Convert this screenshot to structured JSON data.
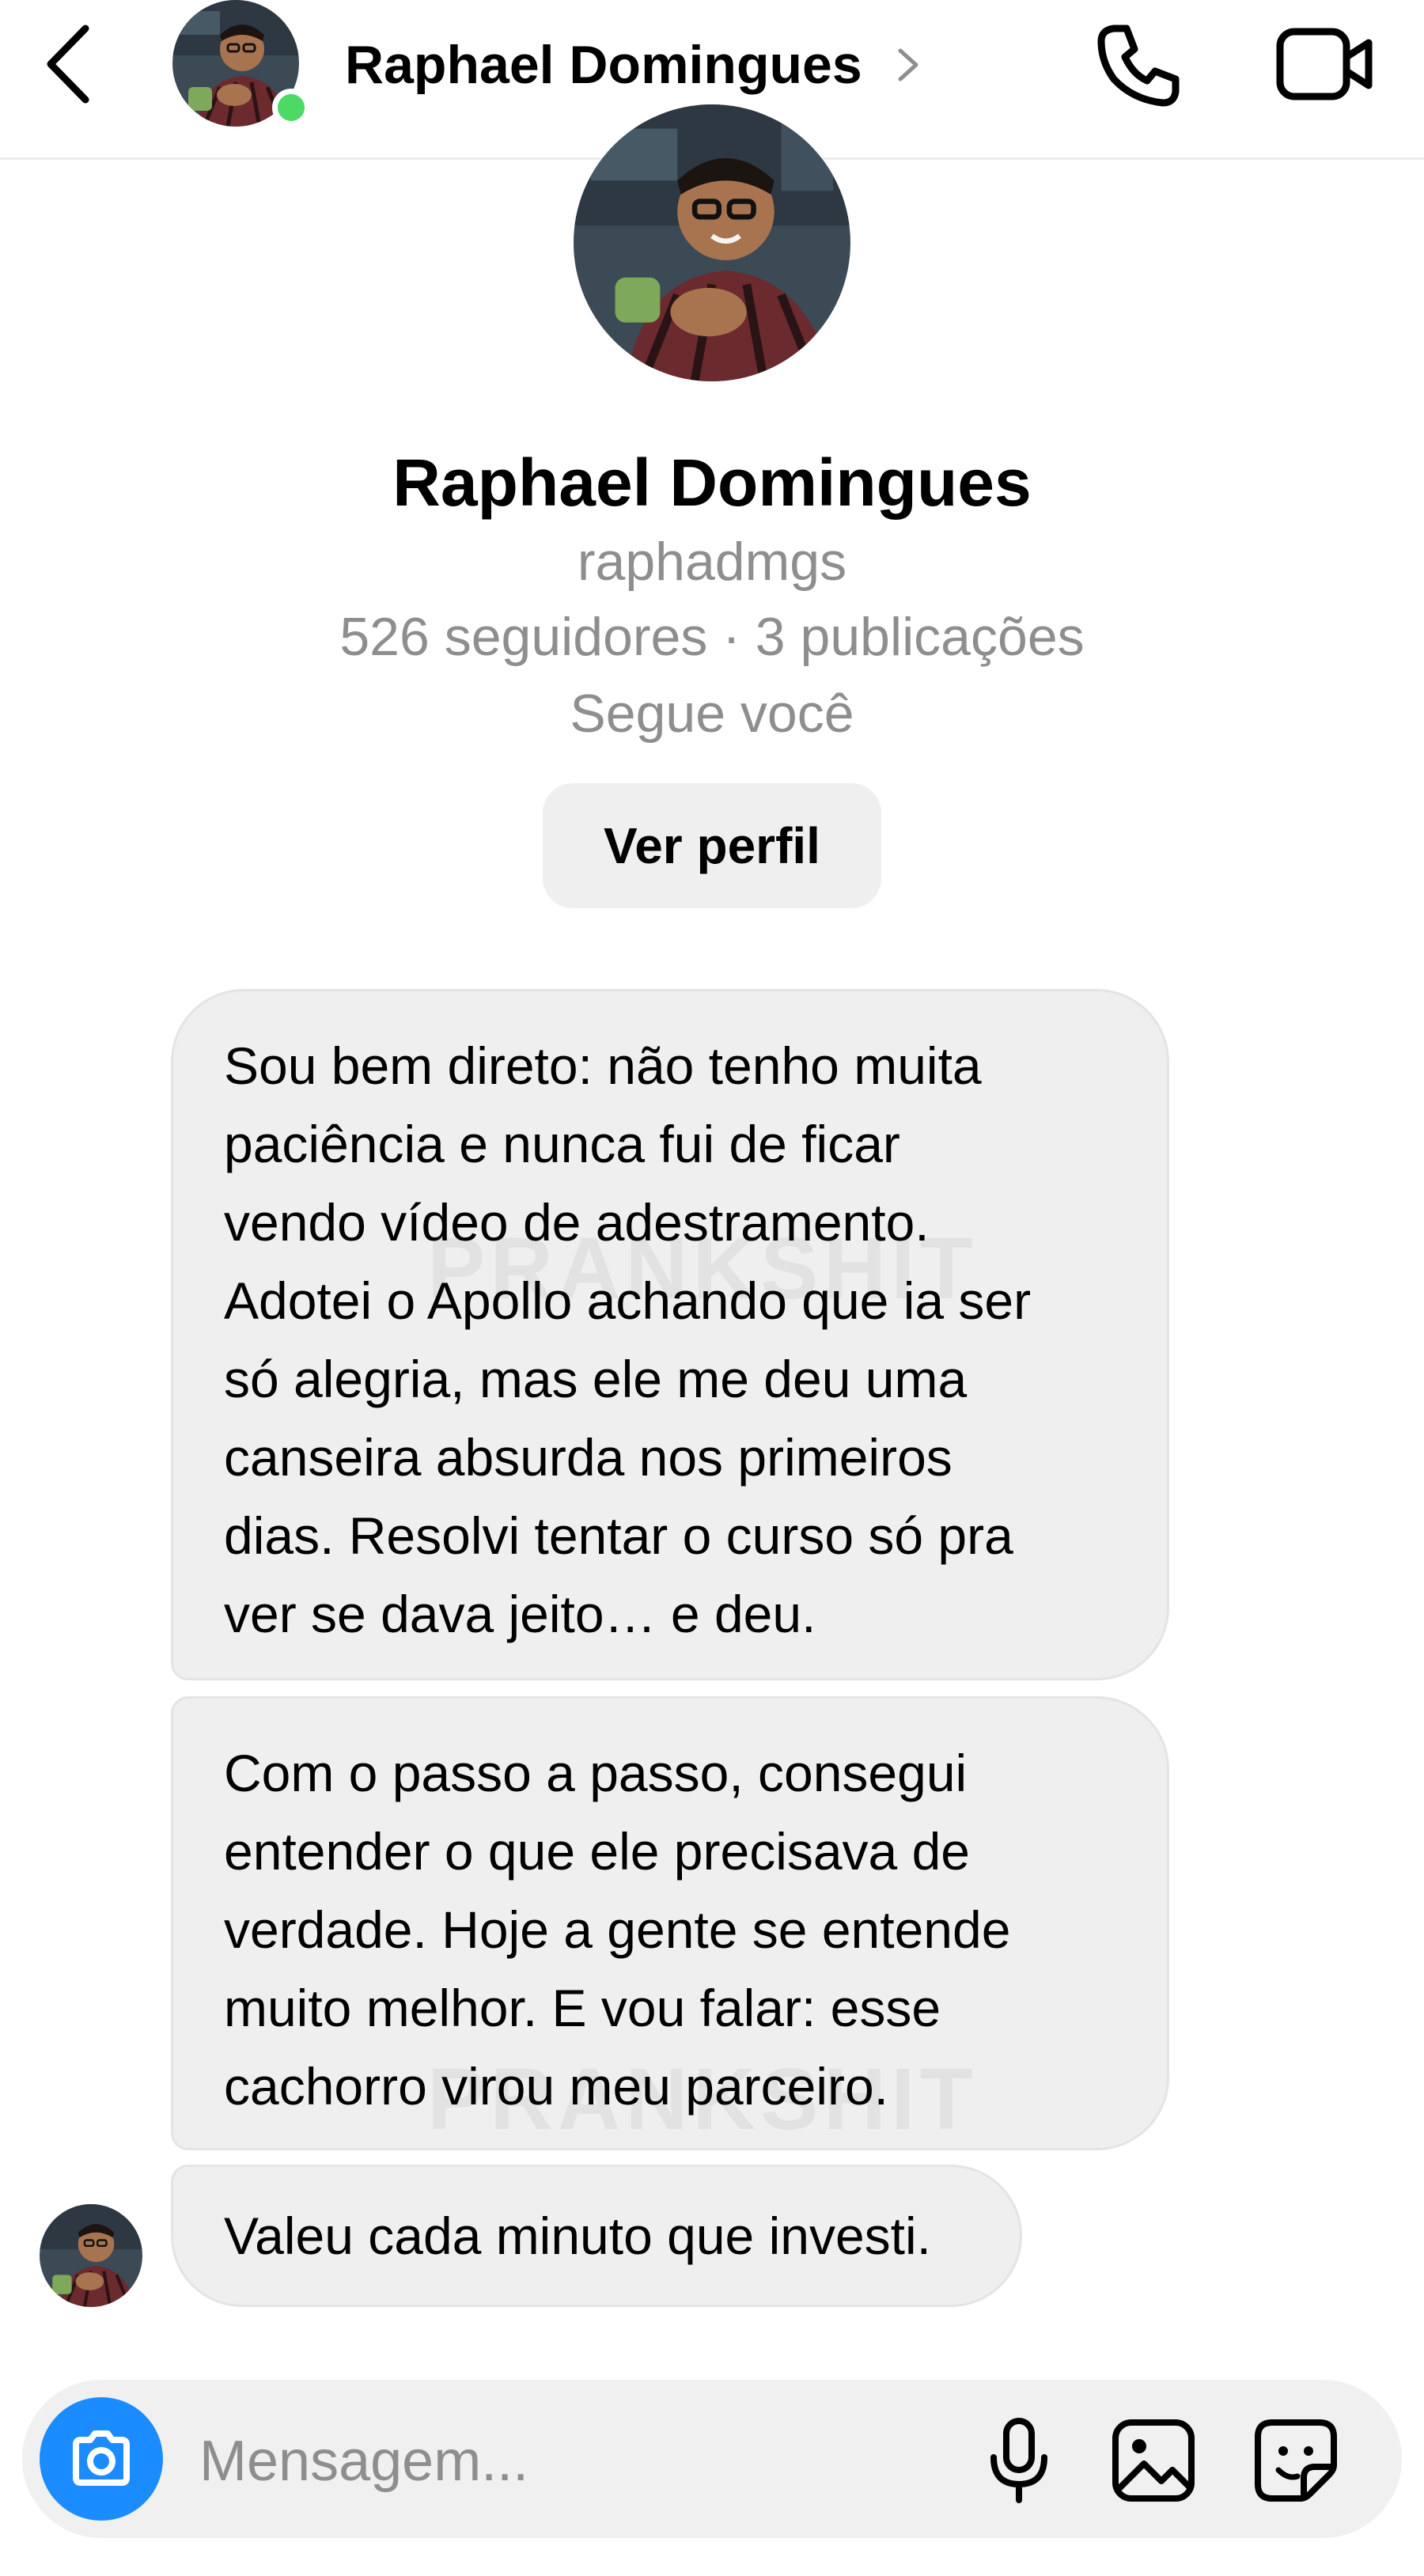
{
  "header": {
    "name": "Raphael Domingues",
    "online_color": "#4cd964",
    "icons": [
      "chevron-left-icon",
      "chevron-right-icon",
      "phone-icon",
      "video-camera-icon"
    ]
  },
  "profile": {
    "name": "Raphael Domingues",
    "username": "raphadmgs",
    "stats": "526 seguidores · 3 publicações",
    "follows": "Segue você",
    "view_profile_label": "Ver perfil"
  },
  "messages": [
    {
      "lines": [
        "Sou bem direto: não tenho muita",
        "paciência e nunca fui de ficar",
        "vendo vídeo de adestramento.",
        "Adotei o Apollo achando que ia ser",
        "só alegria, mas ele me deu uma",
        "canseira absurda nos primeiros",
        "dias. Resolvi tentar o curso só pra",
        "ver se dava jeito… e deu."
      ]
    },
    {
      "lines": [
        "Com o passo a passo, consegui",
        "entender o que ele precisava de",
        "verdade. Hoje a gente se entende",
        "muito melhor. E vou falar: esse",
        "cachorro virou meu parceiro."
      ]
    },
    {
      "lines": [
        "Valeu cada minuto que investi."
      ]
    }
  ],
  "watermark": "PRANKSHIT",
  "composer": {
    "placeholder": "Mensagem...",
    "camera_color": "#1a8cff",
    "icons": [
      "camera-icon",
      "microphone-icon",
      "gallery-icon",
      "sticker-icon"
    ]
  }
}
